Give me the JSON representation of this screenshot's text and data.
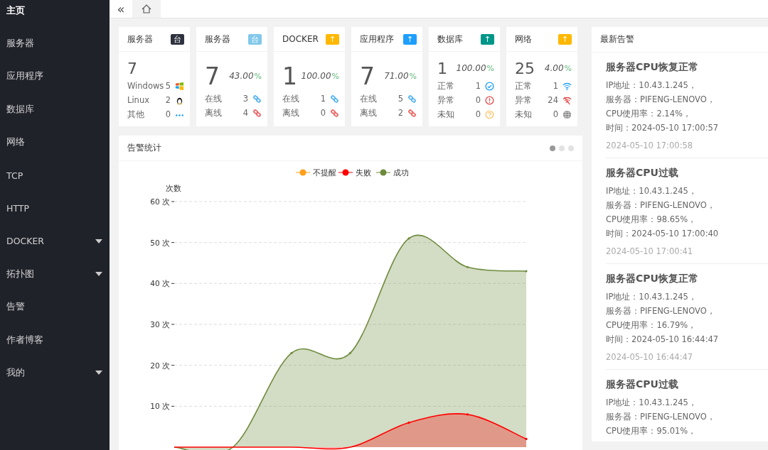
{
  "sidebar": {
    "items": [
      {
        "label": "主页",
        "selected": true,
        "has_children": false
      },
      {
        "label": "服务器",
        "selected": false,
        "has_children": false
      },
      {
        "label": "应用程序",
        "selected": false,
        "has_children": false
      },
      {
        "label": "数据库",
        "selected": false,
        "has_children": false
      },
      {
        "label": "网络",
        "selected": false,
        "has_children": false
      },
      {
        "label": "TCP",
        "selected": false,
        "has_children": false
      },
      {
        "label": "HTTP",
        "selected": false,
        "has_children": false
      },
      {
        "label": "DOCKER",
        "selected": false,
        "has_children": true
      },
      {
        "label": "拓扑图",
        "selected": false,
        "has_children": true
      },
      {
        "label": "告警",
        "selected": false,
        "has_children": false
      },
      {
        "label": "作者博客",
        "selected": false,
        "has_children": false
      },
      {
        "label": "我的",
        "selected": false,
        "has_children": true
      }
    ]
  },
  "topbar": {
    "collapse": "«",
    "tabs": [
      {
        "kind": "home",
        "selected": true
      }
    ]
  },
  "cards": [
    {
      "title": "服务器",
      "badge": "台",
      "color": "#2f3340",
      "total": "7",
      "rows": [
        {
          "label": "Windows",
          "value": "5",
          "kind": "windows"
        },
        {
          "label": "Linux",
          "value": "2",
          "kind": "linux"
        },
        {
          "label": "其他",
          "value": "0",
          "kind": "other"
        }
      ]
    },
    {
      "title": "服务器",
      "badge": "台",
      "color": "#82c8ea",
      "total": "7",
      "percent": "43.00",
      "percent_unit": "%",
      "rows": [
        {
          "label": "在线",
          "value": "3",
          "kind": "online"
        },
        {
          "label": "离线",
          "value": "4",
          "kind": "offline"
        }
      ]
    },
    {
      "title": "DOCKER",
      "badge": "↑",
      "color": "#ffb800",
      "total": "1",
      "percent": "100.00",
      "percent_unit": "%",
      "rows": [
        {
          "label": "在线",
          "value": "1",
          "kind": "online"
        },
        {
          "label": "离线",
          "value": "0",
          "kind": "offline"
        }
      ]
    },
    {
      "title": "应用程序",
      "badge": "↑",
      "color": "#1e9fff",
      "total": "7",
      "percent": "71.00",
      "percent_unit": "%",
      "rows": [
        {
          "label": "在线",
          "value": "5",
          "kind": "online"
        },
        {
          "label": "离线",
          "value": "2",
          "kind": "offline"
        }
      ]
    },
    {
      "title": "数据库",
      "badge": "↑",
      "color": "#009688",
      "total": "1",
      "percent": "100.00",
      "percent_unit": "%",
      "rows": [
        {
          "label": "正常",
          "value": "1",
          "kind": "normal"
        },
        {
          "label": "异常",
          "value": "0",
          "kind": "error"
        },
        {
          "label": "未知",
          "value": "0",
          "kind": "unknown"
        }
      ]
    },
    {
      "title": "网络",
      "badge": "↑",
      "color": "#ffb800",
      "total": "25",
      "percent": "4.00",
      "percent_unit": "%",
      "rows": [
        {
          "label": "正常",
          "value": "1",
          "kind": "wifi"
        },
        {
          "label": "异常",
          "value": "24",
          "kind": "nosignal"
        },
        {
          "label": "未知",
          "value": "0",
          "kind": "globe"
        }
      ]
    }
  ],
  "chart_panel": {
    "title": "告警统计",
    "carousel_dots": [
      {
        "selected": true
      },
      {
        "selected": false
      },
      {
        "selected": false
      }
    ],
    "chart_data": {
      "type": "area",
      "ylabel": "次数",
      "ylim": [
        0,
        60
      ],
      "grid": true,
      "legend": true,
      "yticks": [
        {
          "value": 10,
          "label": "10 次"
        },
        {
          "value": 20,
          "label": "20 次"
        },
        {
          "value": 30,
          "label": "30 次"
        },
        {
          "value": 40,
          "label": "40 次"
        },
        {
          "value": 50,
          "label": "50 次"
        },
        {
          "value": 60,
          "label": "60 次"
        }
      ],
      "series": [
        {
          "name": "不提醒",
          "color": "#ff9f1c",
          "values": [
            null,
            null,
            null,
            null,
            null,
            null,
            null
          ]
        },
        {
          "name": "失败",
          "color": "#ff0000",
          "values": [
            0,
            0,
            0,
            0,
            6,
            8,
            2
          ]
        },
        {
          "name": "成功",
          "color": "#6e8b3d",
          "values": [
            0,
            0,
            23,
            23,
            51,
            44,
            43
          ]
        }
      ]
    }
  },
  "alerts_panel": {
    "title": "最新告警",
    "alerts": [
      {
        "title": "服务器CPU恢复正常",
        "lines": [
          "IP地址：10.43.1.245，",
          "服务器：PIFENG-LENOVO，",
          "CPU使用率：2.14%，",
          "时间：2024-05-10 17:00:57"
        ],
        "stamp": "2024-05-10 17:00:58"
      },
      {
        "title": "服务器CPU过载",
        "lines": [
          "IP地址：10.43.1.245，",
          "服务器：PIFENG-LENOVO，",
          "CPU使用率：98.65%，",
          "时间：2024-05-10 17:00:40"
        ],
        "stamp": "2024-05-10 17:00:41"
      },
      {
        "title": "服务器CPU恢复正常",
        "lines": [
          "IP地址：10.43.1.245，",
          "服务器：PIFENG-LENOVO，",
          "CPU使用率：16.79%，",
          "时间：2024-05-10 16:44:47"
        ],
        "stamp": "2024-05-10 16:44:47"
      },
      {
        "title": "服务器CPU过载",
        "lines": [
          "IP地址：10.43.1.245，",
          "服务器：PIFENG-LENOVO，",
          "CPU使用率：95.01%，"
        ]
      }
    ]
  }
}
